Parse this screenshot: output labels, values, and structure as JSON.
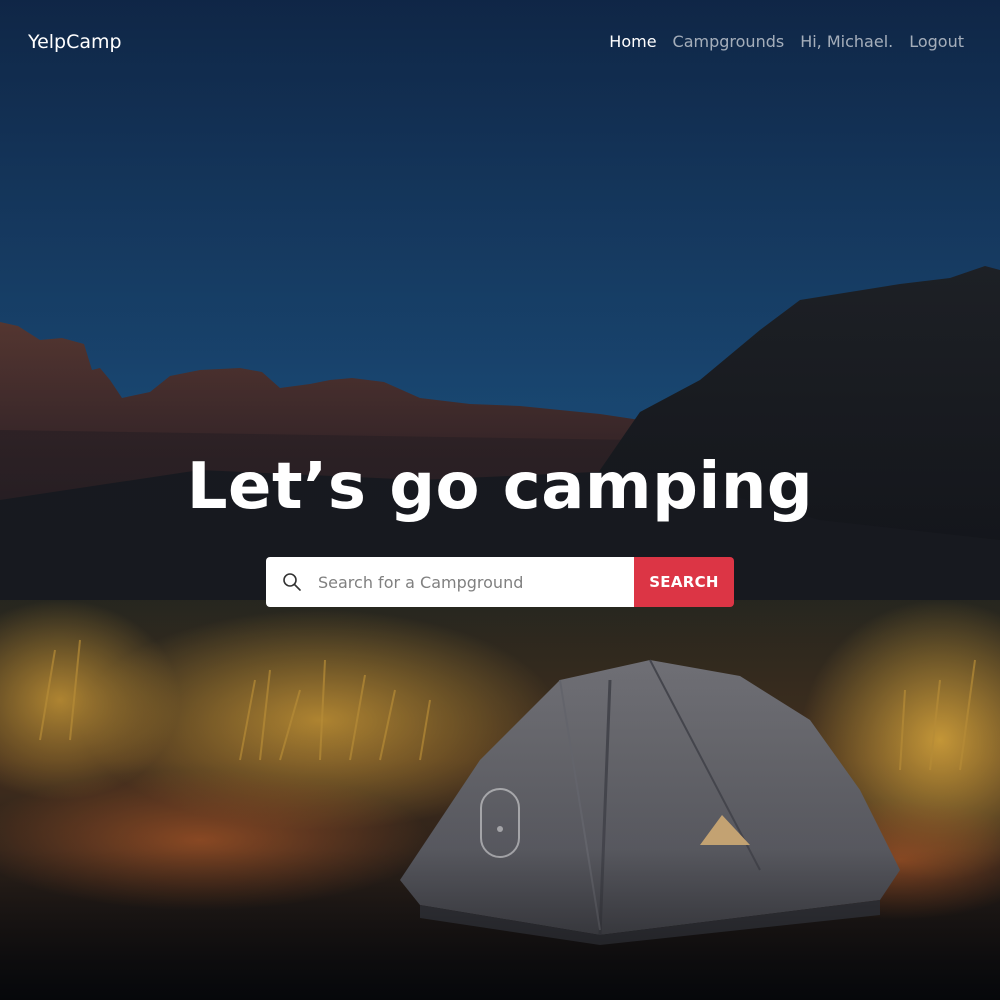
{
  "navbar": {
    "brand": "YelpCamp",
    "links": [
      {
        "label": "Home",
        "active": true
      },
      {
        "label": "Campgrounds",
        "active": false
      },
      {
        "label": "Hi, Michael.",
        "active": false
      },
      {
        "label": "Logout",
        "active": false
      }
    ]
  },
  "hero": {
    "headline": "Let’s go camping",
    "search": {
      "placeholder": "Search for a Campground",
      "value": "",
      "button_label": "SEARCH"
    }
  },
  "icons": {
    "search": "search-icon",
    "scroll": "mouse-scroll-icon"
  },
  "colors": {
    "accent": "#dc3545",
    "sky_top": "#102a4c",
    "sky_bottom": "#1f5a8a",
    "nav_text": "#ffffff"
  }
}
